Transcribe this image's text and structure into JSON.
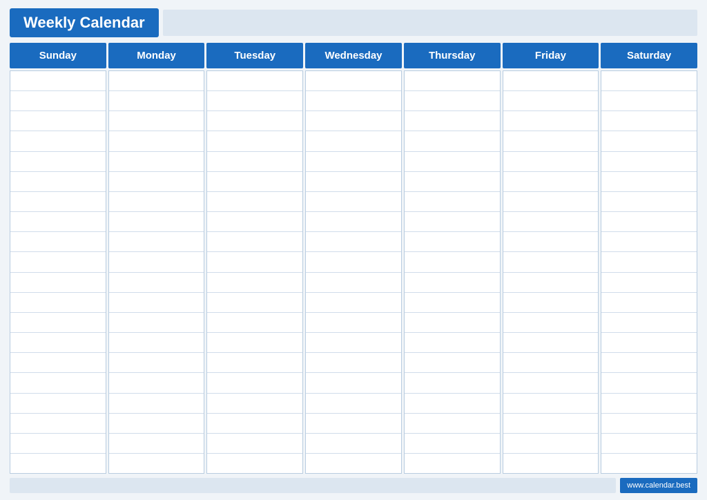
{
  "header": {
    "title": "Weekly Calendar",
    "accent_color": "#1a6bbf"
  },
  "days": [
    {
      "label": "Sunday"
    },
    {
      "label": "Monday"
    },
    {
      "label": "Tuesday"
    },
    {
      "label": "Wednesday"
    },
    {
      "label": "Thursday"
    },
    {
      "label": "Friday"
    },
    {
      "label": "Saturday"
    }
  ],
  "rows_per_column": 20,
  "footer": {
    "url": "www.calendar.best"
  }
}
